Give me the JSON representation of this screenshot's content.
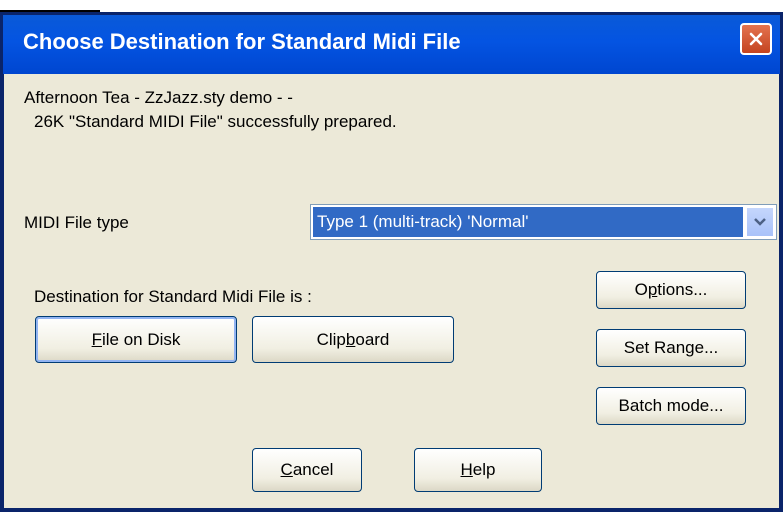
{
  "dialog": {
    "title": "Choose Destination for Standard Midi File"
  },
  "message": {
    "line1": "Afternoon Tea - ZzJazz.sty demo - -",
    "line2": "26K \"Standard MIDI File\" successfully prepared."
  },
  "midi_type": {
    "label": "MIDI File type",
    "selected": "Type 1 (multi-track) 'Normal'"
  },
  "destination": {
    "label": "Destination for Standard Midi File is :",
    "file_on_disk": {
      "mn": "F",
      "rest": "ile on Disk"
    },
    "clipboard": {
      "pre": "Clip",
      "mn": "b",
      "rest": "oard"
    }
  },
  "side_buttons": {
    "options": {
      "pre": "O",
      "mn": "p",
      "rest": "tions..."
    },
    "set_range": "Set Range...",
    "batch_mode": "Batch mode..."
  },
  "footer": {
    "cancel": {
      "mn": "C",
      "rest": "ancel"
    },
    "help": {
      "mn": "H",
      "rest": "elp"
    }
  },
  "icons": [
    "close-icon",
    "chevron-down-icon"
  ],
  "colors": {
    "titlebar": "#0454e2",
    "client_bg": "#ece9d8",
    "selection": "#316ac5",
    "close_button": "#d5532f"
  }
}
